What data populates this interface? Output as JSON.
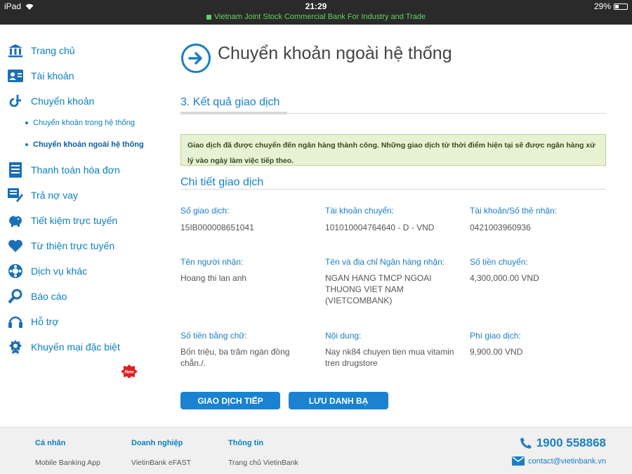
{
  "status_bar": {
    "device": "iPad",
    "time": "21:29",
    "battery": "29%",
    "site": "Vietnam Joint Stock Commercial Bank For Industry and Trade"
  },
  "sidebar": {
    "items": [
      {
        "label": "Trang chủ",
        "icon": "bank-icon"
      },
      {
        "label": "Tài khoản",
        "icon": "account-card-icon"
      },
      {
        "label": "Chuyển khoản",
        "icon": "transfer-icon"
      },
      {
        "label": "Thanh toán hóa đơn",
        "icon": "bill-icon"
      },
      {
        "label": "Trả nợ vay",
        "icon": "loan-icon"
      },
      {
        "label": "Tiết kiệm trực tuyến",
        "icon": "piggy-bank-icon"
      },
      {
        "label": "Từ thiện trực tuyến",
        "icon": "heart-icon"
      },
      {
        "label": "Dịch vụ khác",
        "icon": "services-icon"
      },
      {
        "label": "Báo cáo",
        "icon": "search-report-icon"
      },
      {
        "label": "Hỗ trợ",
        "icon": "headset-icon"
      },
      {
        "label": "Khuyến mại đặc biệt",
        "icon": "award-icon"
      }
    ],
    "sub_items": [
      "Chuyển khoản trong hệ thống",
      "Chuyển khoản ngoài hệ thống"
    ],
    "new_badge": "New"
  },
  "main": {
    "title": "Chuyển khoản ngoài hệ thống",
    "step_title": "3. Kết quả giao dịch",
    "alert": "Giao dịch đã được chuyển đến ngân hàng thành công. Những giao dịch từ thời điểm hiện tại sẽ được ngân hàng xử lý vào ngày làm việc tiếp theo.",
    "detail_title": "Chi tiết giao dịch",
    "fields": [
      {
        "label": "Số giao dịch:",
        "value": "15IB000008651041"
      },
      {
        "label": "Tài khoản chuyển:",
        "value": "101010004764640 - D - VND"
      },
      {
        "label": "Tài khoản/Số thẻ nhận:",
        "value": "0421003960936"
      },
      {
        "label": "Tên người nhận:",
        "value": "Hoang thi lan anh"
      },
      {
        "label": "Tên và địa chỉ Ngân hàng nhận:",
        "value": "NGAN HANG TMCP NGOAI THUONG VIET NAM (VIETCOMBANK)"
      },
      {
        "label": "Số tiền chuyển:",
        "value": "4,300,000.00 VND"
      },
      {
        "label": "Số tiền bằng chữ:",
        "value": "Bốn triệu, ba trăm ngàn đồng chẵn./."
      },
      {
        "label": "Nội dung:",
        "value": "Nay nk84 chuyen tien mua vitamin tren drugstore"
      },
      {
        "label": "Phí giao dịch:",
        "value": "9,900.00 VND"
      }
    ],
    "buttons": {
      "next": "GIAO DỊCH TIẾP",
      "save": "LƯU DANH BẠ"
    }
  },
  "footer": {
    "columns": [
      {
        "heading": "Cá nhân",
        "link": "Mobile Banking App"
      },
      {
        "heading": "Doanh nghiệp",
        "link": "VietinBank eFAST"
      },
      {
        "heading": "Thông tin",
        "link": "Trang chủ VietinBank"
      }
    ],
    "hotline": "1900 558868",
    "email": "contact@vietinbank.vn"
  }
}
